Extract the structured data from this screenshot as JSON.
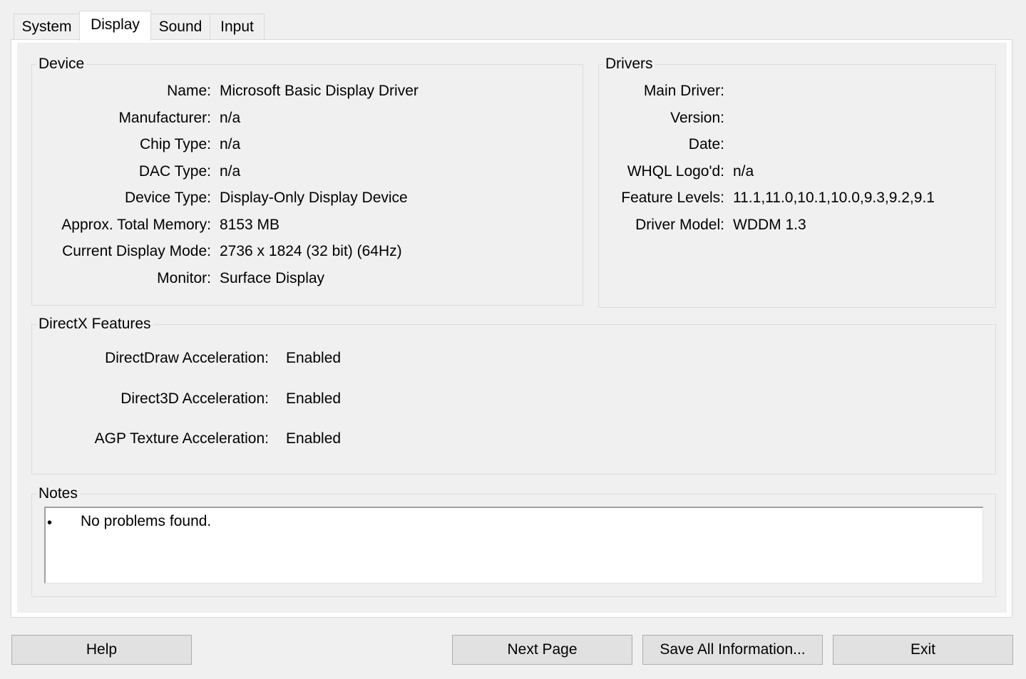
{
  "tabs": [
    {
      "label": "System"
    },
    {
      "label": "Display",
      "active": true
    },
    {
      "label": "Sound"
    },
    {
      "label": "Input"
    }
  ],
  "device": {
    "title": "Device",
    "rows": [
      {
        "label": "Name:",
        "value": "Microsoft Basic Display Driver"
      },
      {
        "label": "Manufacturer:",
        "value": "n/a"
      },
      {
        "label": "Chip Type:",
        "value": "n/a"
      },
      {
        "label": "DAC Type:",
        "value": "n/a"
      },
      {
        "label": "Device Type:",
        "value": "Display-Only Display Device"
      },
      {
        "label": "Approx. Total Memory:",
        "value": "8153 MB"
      },
      {
        "label": "Current Display Mode:",
        "value": "2736 x 1824 (32 bit) (64Hz)"
      },
      {
        "label": "Monitor:",
        "value": "Surface Display"
      }
    ]
  },
  "drivers": {
    "title": "Drivers",
    "rows": [
      {
        "label": "Main Driver:",
        "value": ""
      },
      {
        "label": "Version:",
        "value": ""
      },
      {
        "label": "Date:",
        "value": ""
      },
      {
        "label": "WHQL Logo'd:",
        "value": "n/a"
      },
      {
        "label": "Feature Levels:",
        "value": "11.1,11.0,10.1,10.0,9.3,9.2,9.1"
      },
      {
        "label": "Driver Model:",
        "value": "WDDM 1.3"
      }
    ]
  },
  "directx": {
    "title": "DirectX Features",
    "rows": [
      {
        "label": "DirectDraw Acceleration:",
        "value": "Enabled"
      },
      {
        "label": "Direct3D Acceleration:",
        "value": "Enabled"
      },
      {
        "label": "AGP Texture Acceleration:",
        "value": "Enabled"
      }
    ]
  },
  "notes": {
    "title": "Notes",
    "bullet": "•",
    "items": [
      "No problems found."
    ]
  },
  "buttons": {
    "help": "Help",
    "next_page": "Next Page",
    "save_all": "Save All Information...",
    "exit": "Exit"
  }
}
